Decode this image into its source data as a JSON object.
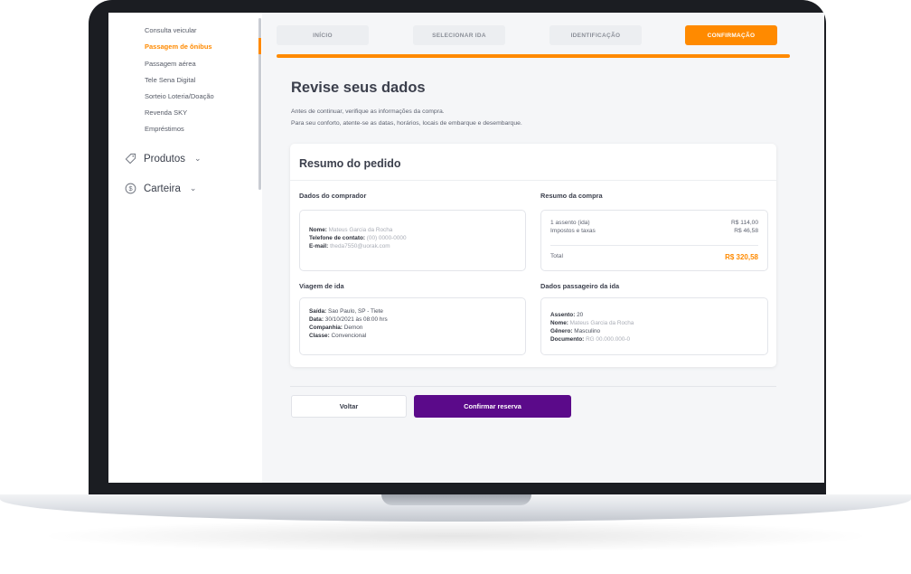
{
  "sidebar": {
    "sub_items": [
      {
        "label": "Consulta veicular",
        "active": false
      },
      {
        "label": "Passagem de ônibus",
        "active": true
      },
      {
        "label": "Passagem aérea",
        "active": false
      },
      {
        "label": "Tele Sena Digital",
        "active": false
      },
      {
        "label": "Sorteio Loteria/Doação",
        "active": false
      },
      {
        "label": "Revenda SKY",
        "active": false
      },
      {
        "label": "Empréstimos",
        "active": false
      }
    ],
    "main_items": [
      {
        "label": "Produtos",
        "icon": "tag-icon"
      },
      {
        "label": "Carteira",
        "icon": "coin-icon"
      }
    ]
  },
  "steps": [
    {
      "label": "INÍCIO",
      "current": false
    },
    {
      "label": "SELECIONAR IDA",
      "current": false
    },
    {
      "label": "IDENTIFICAÇÃO",
      "current": false
    },
    {
      "label": "CONFIRMAÇÃO",
      "current": true
    }
  ],
  "page": {
    "title": "Revise seus dados",
    "intro_1": "Antes de continuar, verifique as informações da compra.",
    "intro_2": "Para seu conforto, atente-se as datas, horários, locais de embarque e desembarque."
  },
  "summary": {
    "title": "Resumo do pedido",
    "buyer": {
      "heading": "Dados do comprador",
      "name_label": "Nome:",
      "name_value": "Mateus Garcia da Rocha",
      "phone_label": "Telefone de contato:",
      "phone_value": "(00) 0000-0000",
      "email_label": "E-mail:",
      "email_value": "theda7550@uorak.com"
    },
    "purchase": {
      "heading": "Resumo da compra",
      "rows": [
        {
          "label": "1 assento (ida)",
          "value": "R$ 114,00"
        },
        {
          "label": "Impostos e taxas",
          "value": "R$ 46,58"
        }
      ],
      "total_label": "Total",
      "total_value": "R$ 320,58"
    },
    "trip": {
      "heading": "Viagem de ida",
      "departure_label": "Saída:",
      "departure_value": "Sao Paulo, SP - Tiete",
      "date_label": "Data:",
      "date_value": "30/10/2021 às 08:00 hrs",
      "company_label": "Companhia:",
      "company_value": "Demon",
      "class_label": "Classe:",
      "class_value": "Convencional"
    },
    "passenger": {
      "heading": "Dados passageiro da ida",
      "seat_label": "Assento:",
      "seat_value": "20",
      "name_label": "Nome:",
      "name_value": "Mateus Garcia da Rocha",
      "gender_label": "Gênero:",
      "gender_value": "Masculino",
      "doc_label": "Documento:",
      "doc_value": "RG 00.000.000-0"
    }
  },
  "actions": {
    "back_label": "Voltar",
    "confirm_label": "Confirmar reserva"
  },
  "colors": {
    "accent": "#ff8a00",
    "primary_button": "#5b0a8a",
    "background": "#f5f6f8"
  }
}
